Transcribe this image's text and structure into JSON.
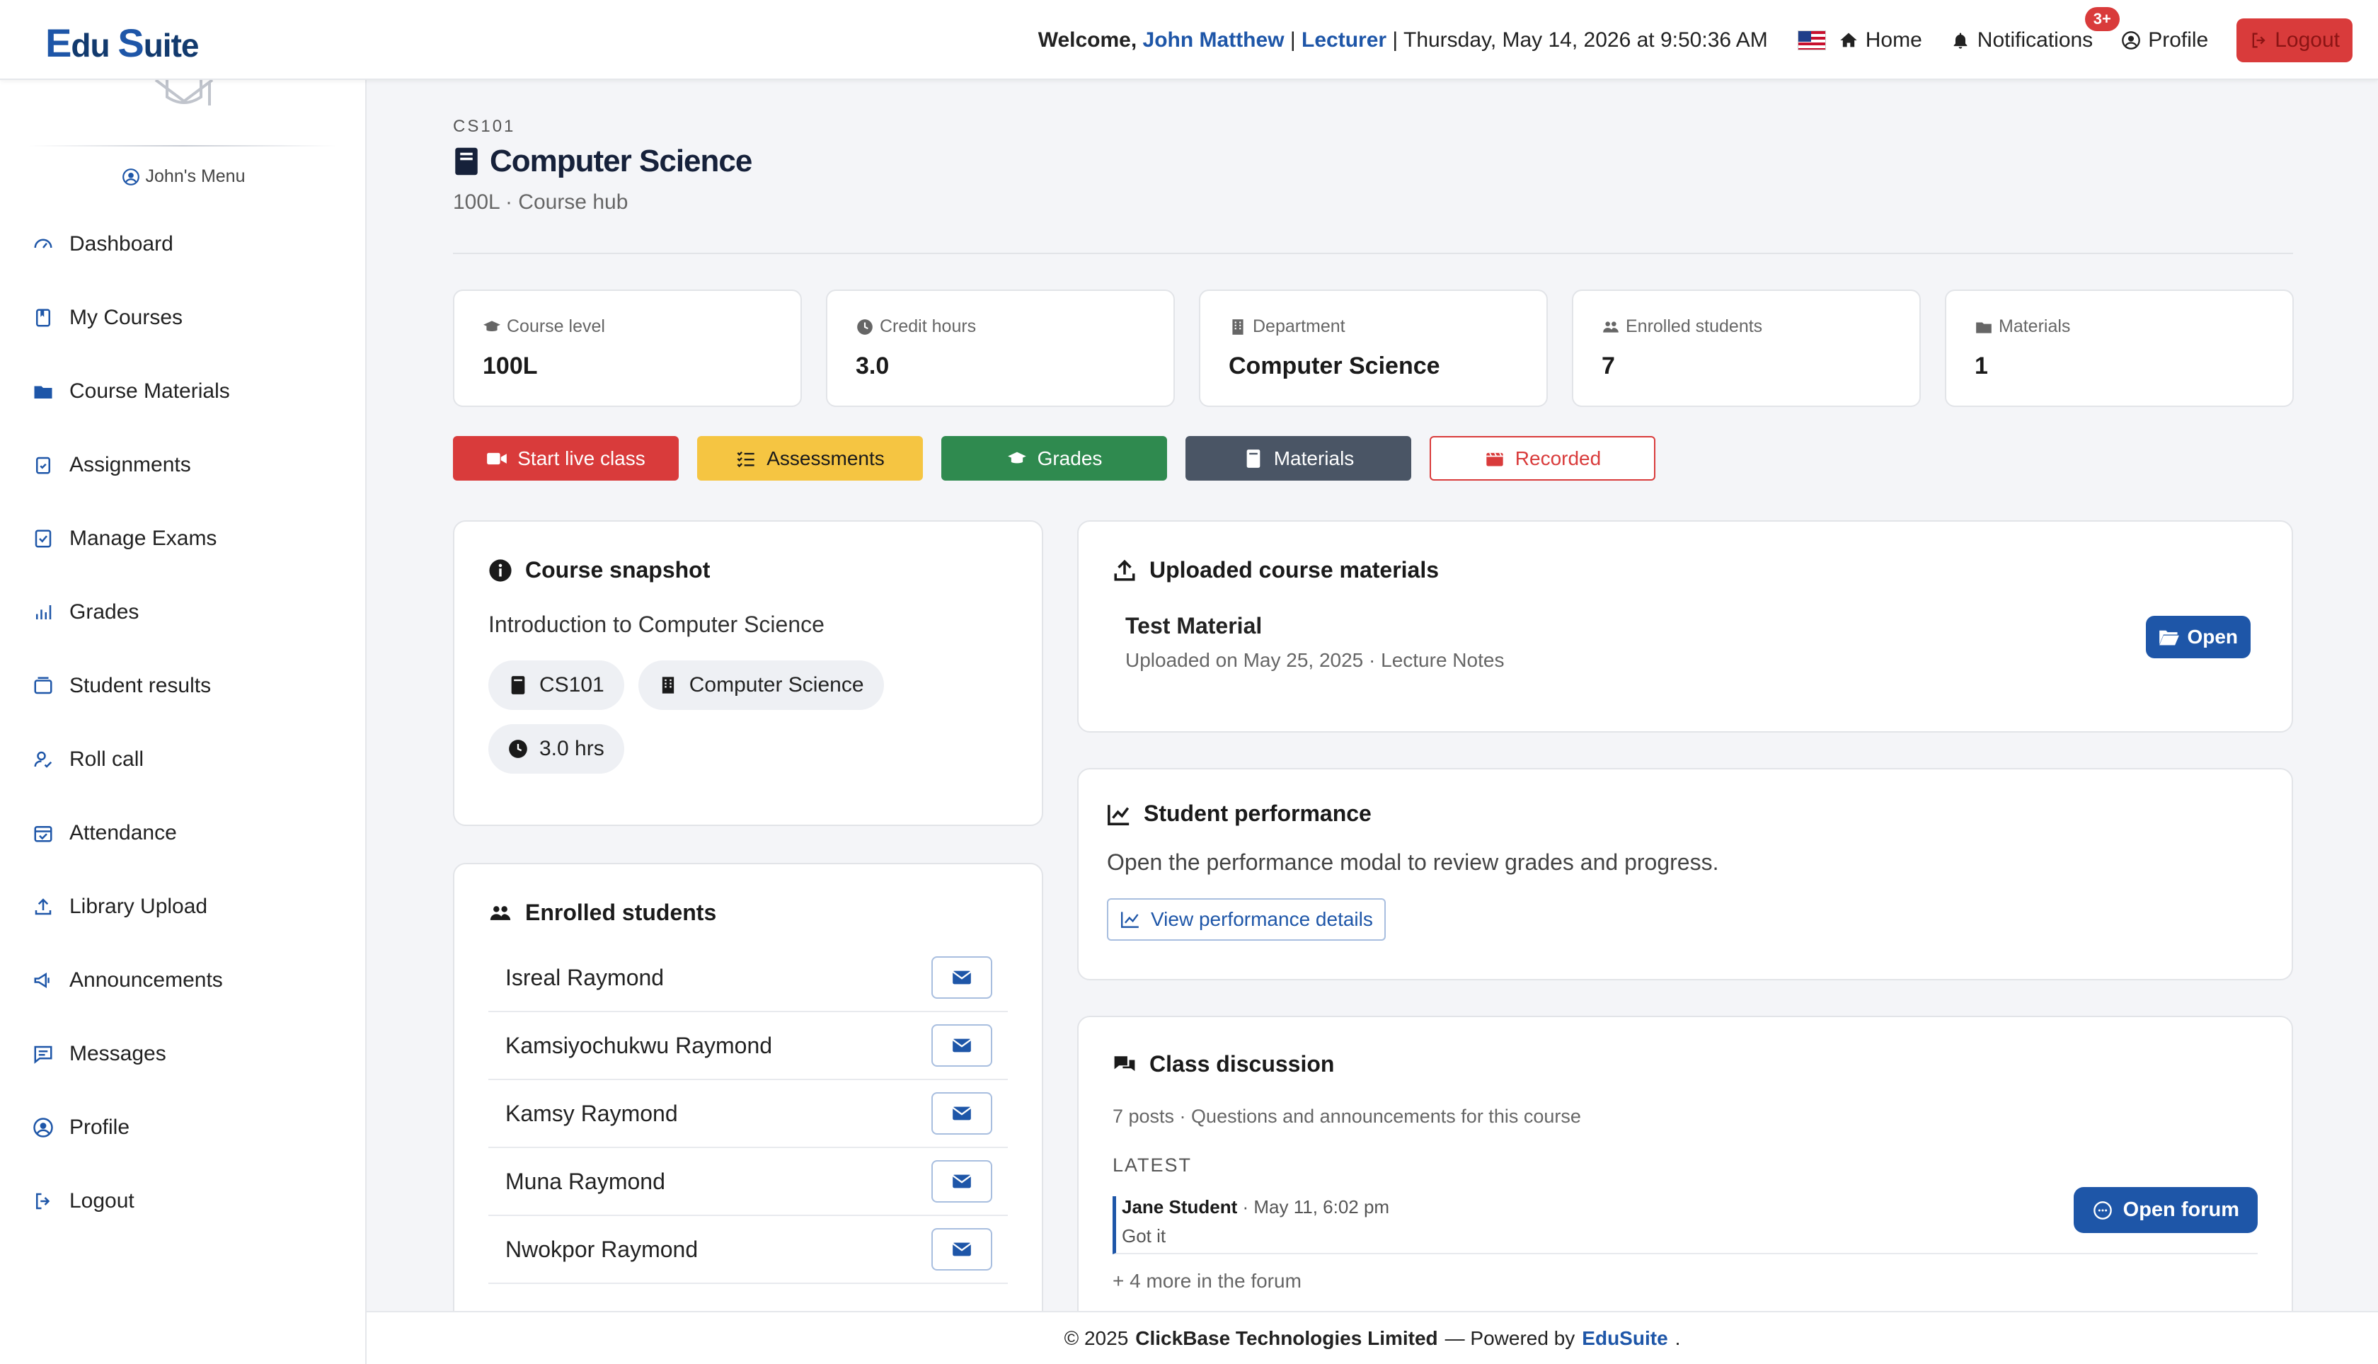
{
  "brand": {
    "e": "E",
    "du": "du",
    "s": "S",
    "uite": "uite"
  },
  "topbar": {
    "welcome_prefix": "Welcome,",
    "user_name": "John Matthew",
    "sep1": "|",
    "role": "Lecturer",
    "datetime": "| Thursday, May 14, 2026 at 9:50:36 AM",
    "home": "Home",
    "notifications": "Notifications",
    "notif_badge": "3+",
    "profile": "Profile",
    "logout": "Logout"
  },
  "sidebar": {
    "menu_title": "John's Menu",
    "items": [
      {
        "label": "Dashboard",
        "icon": "gauge-icon"
      },
      {
        "label": "My Courses",
        "icon": "book-icon"
      },
      {
        "label": "Course Materials",
        "icon": "folder-icon"
      },
      {
        "label": "Assignments",
        "icon": "clipboard-icon"
      },
      {
        "label": "Manage Exams",
        "icon": "checklist-icon"
      },
      {
        "label": "Grades",
        "icon": "bar-chart-icon"
      },
      {
        "label": "Student results",
        "icon": "card-icon"
      },
      {
        "label": "Roll call",
        "icon": "person-check-icon"
      },
      {
        "label": "Attendance",
        "icon": "calendar-check-icon"
      },
      {
        "label": "Library Upload",
        "icon": "upload-icon"
      },
      {
        "label": "Announcements",
        "icon": "megaphone-icon"
      },
      {
        "label": "Messages",
        "icon": "message-icon"
      },
      {
        "label": "Profile",
        "icon": "person-circle-icon"
      },
      {
        "label": "Logout",
        "icon": "logout-icon"
      }
    ]
  },
  "course": {
    "code": "CS101",
    "title": "Computer Science",
    "subtitle": "100L · Course hub"
  },
  "stats": [
    {
      "label": "Course level",
      "value": "100L"
    },
    {
      "label": "Credit hours",
      "value": "3.0"
    },
    {
      "label": "Department",
      "value": "Computer Science"
    },
    {
      "label": "Enrolled students",
      "value": "7"
    },
    {
      "label": "Materials",
      "value": "1"
    }
  ],
  "actions": {
    "live": "Start live class",
    "assessments": "Assessments",
    "grades": "Grades",
    "materials": "Materials",
    "recorded": "Recorded"
  },
  "snapshot": {
    "title": "Course snapshot",
    "description": "Introduction to Computer Science",
    "pills": {
      "code": "CS101",
      "dept": "Computer Science",
      "hours": "3.0 hrs"
    }
  },
  "enrolled": {
    "title": "Enrolled students",
    "students": [
      "Isreal Raymond",
      "Kamsiyochukwu Raymond",
      "Kamsy Raymond",
      "Muna Raymond",
      "Nwokpor Raymond"
    ]
  },
  "materials": {
    "title": "Uploaded course materials",
    "item_name": "Test Material",
    "item_meta": "Uploaded on May 25, 2025 · Lecture Notes",
    "open_label": "Open"
  },
  "performance": {
    "title": "Student performance",
    "text": "Open the performance modal to review grades and progress.",
    "button": "View performance details"
  },
  "discussion": {
    "title": "Class discussion",
    "meta": "7 posts · Questions and announcements for this course",
    "forum_button": "Open forum",
    "latest_label": "LATEST",
    "post_author": "Jane Student",
    "post_time": "· May 11, 6:02 pm",
    "post_text": "Got it",
    "more": "+ 4 more in the forum"
  },
  "footer": {
    "copyright": "© 2025",
    "company": "ClickBase Technologies Limited",
    "powered": "— Powered by",
    "product": "EduSuite",
    "dot": "."
  },
  "colors": {
    "primary": "#1e56a8",
    "danger": "#d93b3b",
    "warning": "#f5c542",
    "success": "#2f8a4f",
    "slate": "#4a5565"
  }
}
